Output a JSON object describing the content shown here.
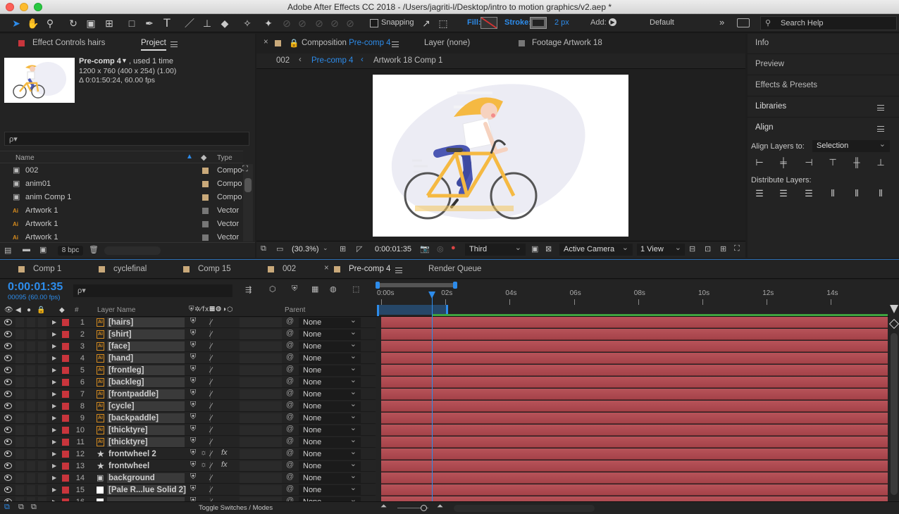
{
  "window": {
    "title": "Adobe After Effects CC 2018 - /Users/jagriti-l/Desktop/intro to motion graphics/v2.aep *"
  },
  "toolbar": {
    "tools": [
      "selection-tool-icon",
      "hand-tool-icon",
      "zoom-tool-icon",
      "rotation-tool-icon",
      "camera-tool-icon",
      "pan-behind-tool-icon",
      "rectangle-tool-icon",
      "pen-tool-icon",
      "type-tool-icon",
      "brush-tool-icon",
      "clone-stamp-tool-icon",
      "eraser-tool-icon",
      "roto-brush-tool-icon",
      "puppet-pin-tool-icon"
    ],
    "snapping_label": "Snapping",
    "fill_label": "Fill:",
    "stroke_label": "Stroke:",
    "stroke_width": "2 px",
    "add_label": "Add:",
    "workspace": "Default",
    "search_placeholder": "Search Help"
  },
  "project_panel": {
    "tab_effect_controls": "Effect Controls hairs",
    "tab_project": "Project",
    "selected_item_name": "Pre-comp 4",
    "selected_item_used": ", used 1 time",
    "selected_item_dims": "1200 x 760  (400 x 254) (1.00)",
    "selected_item_duration": "Δ 0:01:50:24, 60.00 fps",
    "search_placeholder": "ρ▾",
    "col_name": "Name",
    "col_type": "Type",
    "items": [
      {
        "name": "002",
        "type": "Compo",
        "icon": "composition-icon",
        "color": "#c9a97a"
      },
      {
        "name": "anim01",
        "type": "Compo",
        "icon": "composition-icon",
        "color": "#c9a97a"
      },
      {
        "name": "anim Comp 1",
        "type": "Compo",
        "icon": "composition-icon",
        "color": "#c9a97a"
      },
      {
        "name": "Artwork 1",
        "type": "Vector",
        "icon": "vector-file-icon",
        "color": "#777777"
      },
      {
        "name": "Artwork 1",
        "type": "Vector",
        "icon": "vector-file-icon",
        "color": "#777777"
      },
      {
        "name": "Artwork 1",
        "type": "Vector",
        "icon": "vector-file-icon",
        "color": "#777777"
      }
    ],
    "bpc": "8 bpc"
  },
  "composition_panel": {
    "tab_comp_prefix": "Composition",
    "tab_comp_name": "Pre-comp 4",
    "tab_layer": "Layer (none)",
    "tab_footage": "Footage Artwork 18",
    "breadcrumbs": [
      "002",
      "Pre-comp 4",
      "Artwork 18 Comp 1"
    ],
    "zoom": "(30.3%)",
    "timecode": "0:00:01:35",
    "resolution": "Third",
    "camera": "Active Camera",
    "views": "1 View"
  },
  "right_panels": {
    "info": "Info",
    "preview": "Preview",
    "effects_presets": "Effects & Presets",
    "libraries": "Libraries",
    "align": "Align",
    "align_layers_to_label": "Align Layers to:",
    "align_layers_to_value": "Selection",
    "distribute_label": "Distribute Layers:"
  },
  "timeline": {
    "tabs": [
      {
        "label": "Comp 1",
        "color": "#c9a97a"
      },
      {
        "label": "cyclefinal",
        "color": "#c9a97a"
      },
      {
        "label": "Comp 15",
        "color": "#c9a97a"
      },
      {
        "label": "002",
        "color": "#c9a97a"
      },
      {
        "label": "Pre-comp 4",
        "color": "#c9a97a"
      },
      {
        "label": "Render Queue",
        "color": ""
      }
    ],
    "timecode": "0:00:01:35",
    "frame_info": "00095 (60.00 fps)",
    "search_placeholder": "ρ▾",
    "col_layer_name": "Layer Name",
    "col_parent": "Parent",
    "col_hash": "#",
    "ruler_labels": [
      "0:00s",
      "02s",
      "04s",
      "06s",
      "08s",
      "10s",
      "12s",
      "14s"
    ],
    "playhead_seconds": 1.58,
    "toggle_label": "Toggle Switches / Modes",
    "layers": [
      {
        "num": "1",
        "name": "[hairs]",
        "type": "ai",
        "parent": "None",
        "fx": false
      },
      {
        "num": "2",
        "name": "[shirt]",
        "type": "ai",
        "parent": "None",
        "fx": false
      },
      {
        "num": "3",
        "name": "[face]",
        "type": "ai",
        "parent": "None",
        "fx": false
      },
      {
        "num": "4",
        "name": "[hand]",
        "type": "ai",
        "parent": "None",
        "fx": false
      },
      {
        "num": "5",
        "name": "[frontleg]",
        "type": "ai",
        "parent": "None",
        "fx": false
      },
      {
        "num": "6",
        "name": "[backleg]",
        "type": "ai",
        "parent": "None",
        "fx": false
      },
      {
        "num": "7",
        "name": "[frontpaddle]",
        "type": "ai",
        "parent": "None",
        "fx": false
      },
      {
        "num": "8",
        "name": "[cycle]",
        "type": "ai",
        "parent": "None",
        "fx": false
      },
      {
        "num": "9",
        "name": "[backpaddle]",
        "type": "ai",
        "parent": "None",
        "fx": false
      },
      {
        "num": "10",
        "name": "[thicktyre]",
        "type": "ai",
        "parent": "None",
        "fx": false
      },
      {
        "num": "11",
        "name": "[thicktyre]",
        "type": "ai",
        "parent": "None",
        "fx": false
      },
      {
        "num": "12",
        "name": "frontwheel 2",
        "type": "shape",
        "parent": "None",
        "fx": true
      },
      {
        "num": "13",
        "name": "frontwheel",
        "type": "shape",
        "parent": "None",
        "fx": true
      },
      {
        "num": "14",
        "name": "background",
        "type": "comp",
        "parent": "None",
        "fx": false
      },
      {
        "num": "15",
        "name": "[Pale R...lue Solid 2]",
        "type": "solid",
        "parent": "None",
        "fx": false
      },
      {
        "num": "16",
        "name": "",
        "type": "solid",
        "parent": "None",
        "fx": false
      }
    ]
  },
  "colors": {
    "accent_blue": "#2d8ceb",
    "label_red": "#c8353c",
    "layer_bar": "#b3484f"
  }
}
